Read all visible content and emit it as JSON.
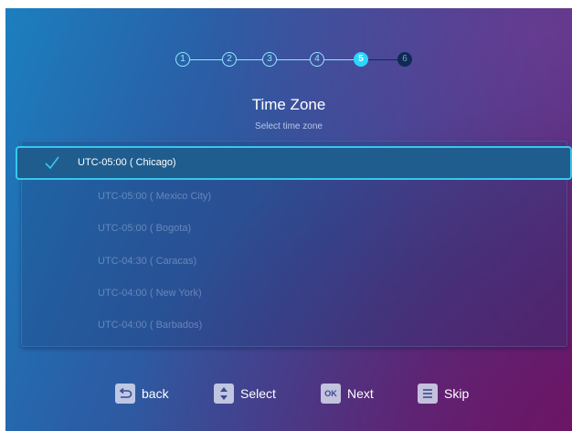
{
  "stepper": {
    "steps": [
      "1",
      "2",
      "3",
      "4",
      "5",
      "6"
    ],
    "current_step": 5
  },
  "header": {
    "title": "Time Zone",
    "subtitle": "Select time zone"
  },
  "timezone_list": {
    "items": [
      {
        "label": "UTC-05:00 ( Chicago)",
        "selected": true
      },
      {
        "label": "UTC-05:00 ( Mexico City)",
        "selected": false
      },
      {
        "label": "UTC-05:00 ( Bogota)",
        "selected": false
      },
      {
        "label": "UTC-04:30 ( Caracas)",
        "selected": false
      },
      {
        "label": "UTC-04:00 ( New York)",
        "selected": false
      },
      {
        "label": "UTC-04:00 ( Barbados)",
        "selected": false
      }
    ]
  },
  "footer": {
    "back_label": "back",
    "select_label": "Select",
    "ok_key": "OK",
    "next_label": "Next",
    "skip_label": "Skip"
  },
  "colors": {
    "accent": "#36c8ee",
    "active_step": "#29d8ff",
    "selected_row": "#1f5d8e"
  }
}
